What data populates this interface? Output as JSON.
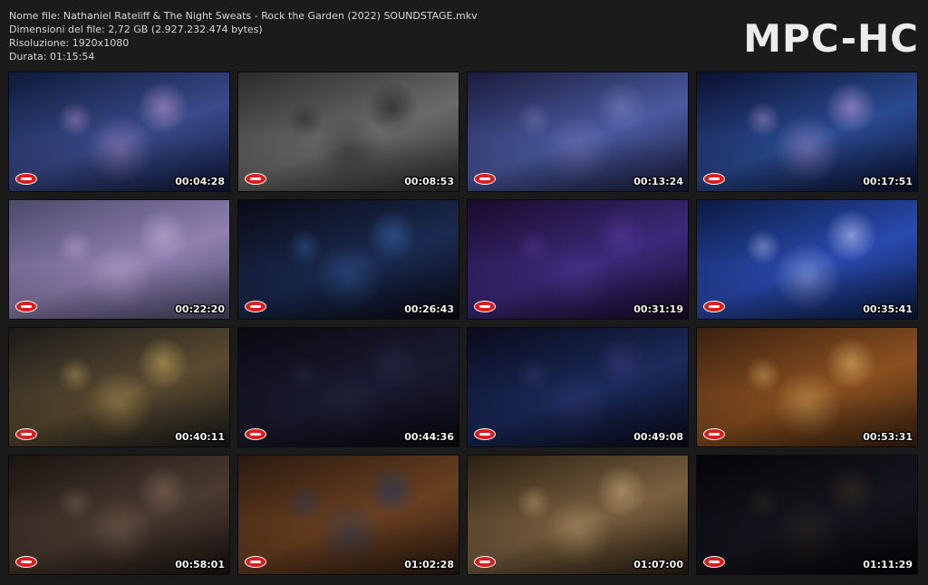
{
  "file_info": {
    "name_line": "Nome file: Nathaniel Rateliff & The Night Sweats - Rock the Garden (2022) SOUNDSTAGE.mkv",
    "size_line": "Dimensioni del file: 2,72 GB (2.927.232.474 bytes)",
    "resolution_line": "Risoluzione: 1920x1080",
    "duration_line": "Durata: 01:15:54"
  },
  "logo": "MPC-HC",
  "thumbnails": [
    {
      "time": "00:04:28",
      "colors": [
        "#0d1a3a",
        "#3a4a8a",
        "#c9a0d8"
      ]
    },
    {
      "time": "00:08:53",
      "colors": [
        "#2b2b2b",
        "#6a6a6a",
        "#1a1a1a"
      ]
    },
    {
      "time": "00:13:24",
      "colors": [
        "#1a1a3a",
        "#4a5aa0",
        "#8080c0"
      ]
    },
    {
      "time": "00:17:51",
      "colors": [
        "#0a1030",
        "#2a4a90",
        "#d0a8e8"
      ]
    },
    {
      "time": "00:22:20",
      "colors": [
        "#4a4a6a",
        "#9080b0",
        "#c8b0d8"
      ]
    },
    {
      "time": "00:26:43",
      "colors": [
        "#0a0a14",
        "#1a2a50",
        "#3a6ab0"
      ]
    },
    {
      "time": "00:31:19",
      "colors": [
        "#1a0a2a",
        "#3a2a7a",
        "#5a3aa0"
      ]
    },
    {
      "time": "00:35:41",
      "colors": [
        "#0a1a40",
        "#2a4ab0",
        "#d0d8ff"
      ]
    },
    {
      "time": "00:40:11",
      "colors": [
        "#1a1a1a",
        "#5a4a30",
        "#d0b060"
      ]
    },
    {
      "time": "00:44:36",
      "colors": [
        "#0a0a12",
        "#1a1a30",
        "#2a2a4a"
      ]
    },
    {
      "time": "00:49:08",
      "colors": [
        "#0a0a1a",
        "#1a2a5a",
        "#3a3a7a"
      ]
    },
    {
      "time": "00:53:31",
      "colors": [
        "#3a2010",
        "#8a5020",
        "#e8c070"
      ]
    },
    {
      "time": "00:58:01",
      "colors": [
        "#1a1410",
        "#4a3a30",
        "#8a7060"
      ]
    },
    {
      "time": "01:02:28",
      "colors": [
        "#2a1a10",
        "#6a4020",
        "#1a3a6a"
      ]
    },
    {
      "time": "01:07:00",
      "colors": [
        "#2a2010",
        "#7a6040",
        "#d0b080"
      ]
    },
    {
      "time": "01:11:29",
      "colors": [
        "#050508",
        "#15151e",
        "#3a3020"
      ]
    }
  ]
}
